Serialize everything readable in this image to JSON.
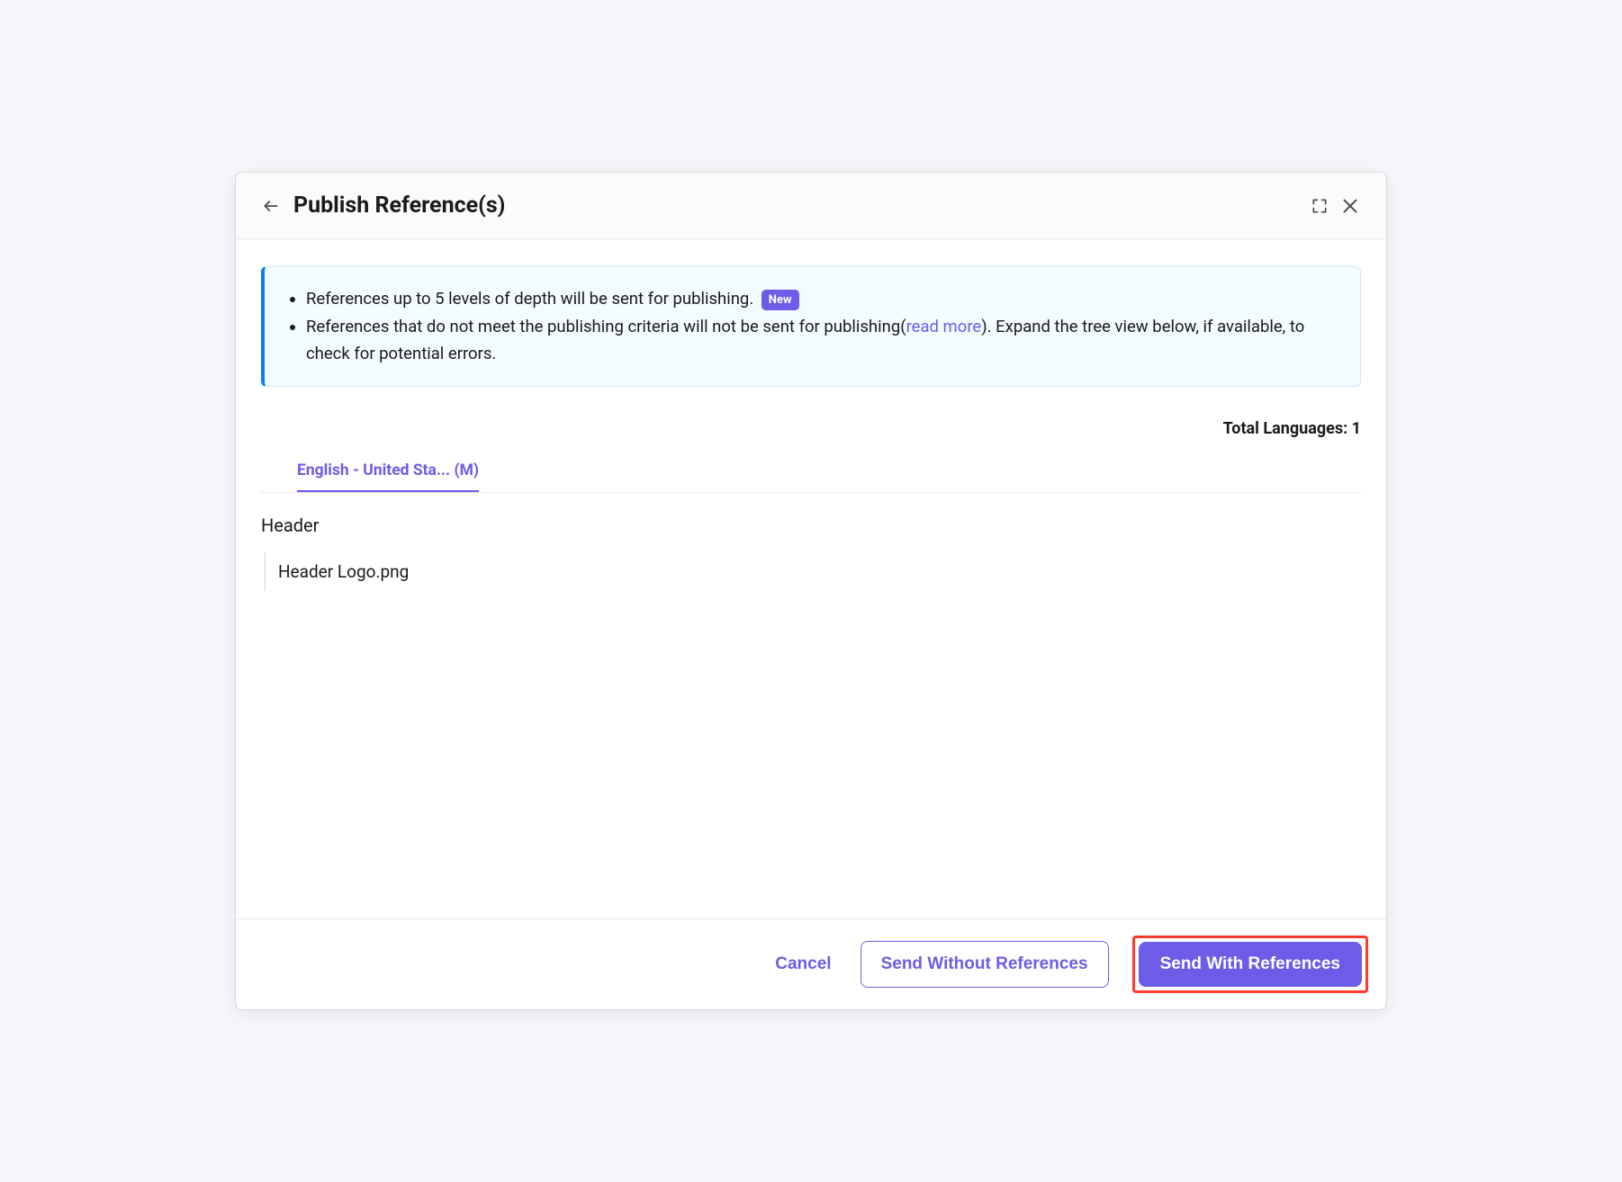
{
  "header": {
    "title": "Publish Reference(s)"
  },
  "banner": {
    "item1_text": "References up to 5 levels of depth will be sent for publishing.",
    "badge_new": "New",
    "item2_prefix": "References that do not meet the publishing criteria will not be sent for publishing(",
    "item2_link": "read more",
    "item2_suffix": "). Expand the tree view below, if available, to check for potential errors."
  },
  "total_languages_label": "Total Languages: 1",
  "tabs": {
    "active": "English - United Sta... (M)"
  },
  "tree": {
    "root": "Header",
    "children": [
      "Header Logo.png"
    ]
  },
  "footer": {
    "cancel": "Cancel",
    "send_without": "Send Without References",
    "send_with": "Send With References"
  }
}
